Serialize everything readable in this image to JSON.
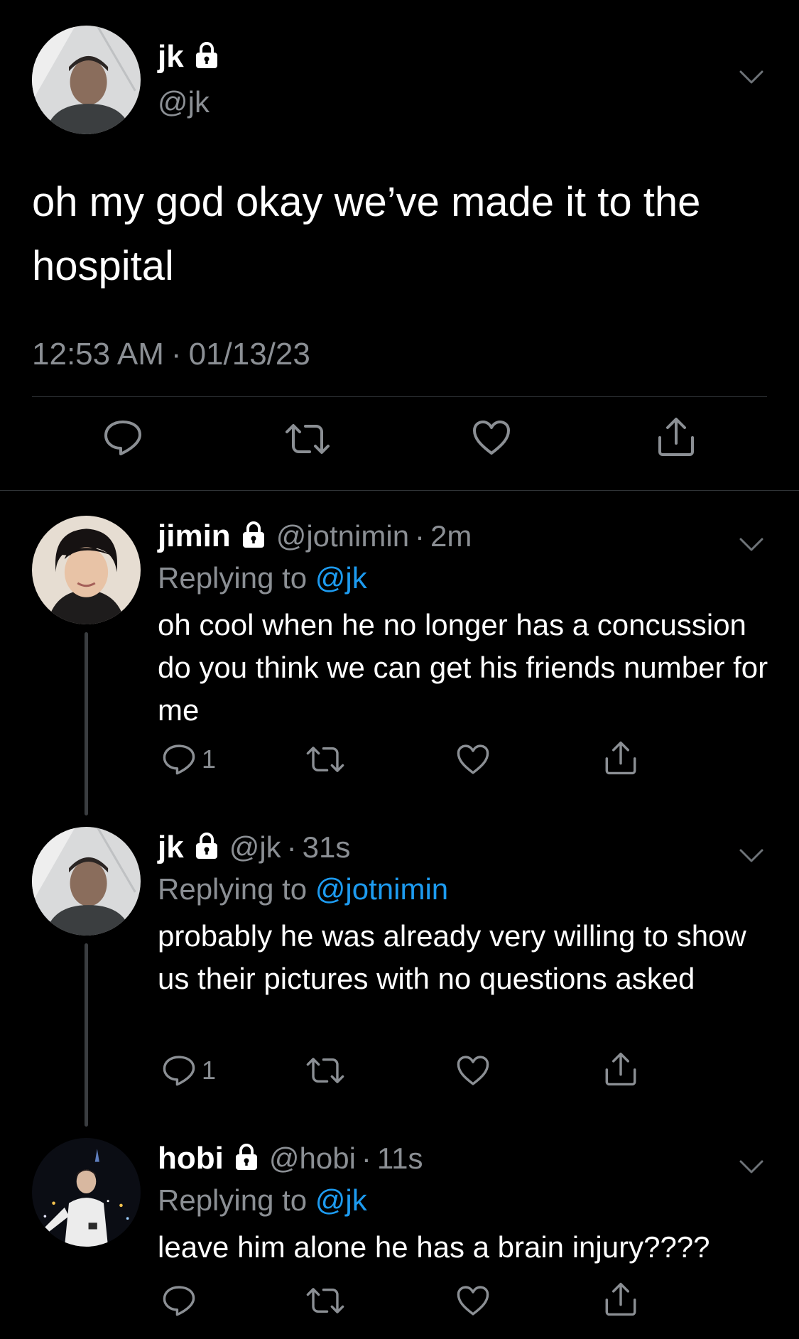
{
  "main": {
    "name": "jk",
    "handle": "@jk",
    "text": "oh my god okay we’ve made it to the hospital",
    "time": "12:53 AM",
    "separator": "·",
    "date": "01/13/23",
    "icons": [
      "lock-icon",
      "chevron-down-icon",
      "reply-icon",
      "retweet-icon",
      "like-icon",
      "share-icon"
    ]
  },
  "replies": [
    {
      "name": "jimin",
      "handle": "@jotnimin",
      "separator": "·",
      "time": "2m",
      "replying_prefix": "Replying to ",
      "replying_to": "@jk",
      "text": "oh cool when he no longer has a concussion do you think we can get his friends number for me",
      "reply_count": "1"
    },
    {
      "name": "jk",
      "handle": "@jk",
      "separator": "·",
      "time": "31s",
      "replying_prefix": "Replying to ",
      "replying_to": "@jotnimin",
      "text": "probably he was already very willing to show us their pictures with no questions asked",
      "reply_count": "1"
    },
    {
      "name": "hobi",
      "handle": "@hobi",
      "separator": "·",
      "time": "11s",
      "replying_prefix": "Replying to ",
      "replying_to": "@jk",
      "text": "leave him alone he has a brain injury????",
      "reply_count": ""
    }
  ],
  "colors": {
    "background": "#000000",
    "text": "#ffffff",
    "secondary": "#8b8f94",
    "link": "#1d9bf0",
    "divider": "#2f3336"
  }
}
